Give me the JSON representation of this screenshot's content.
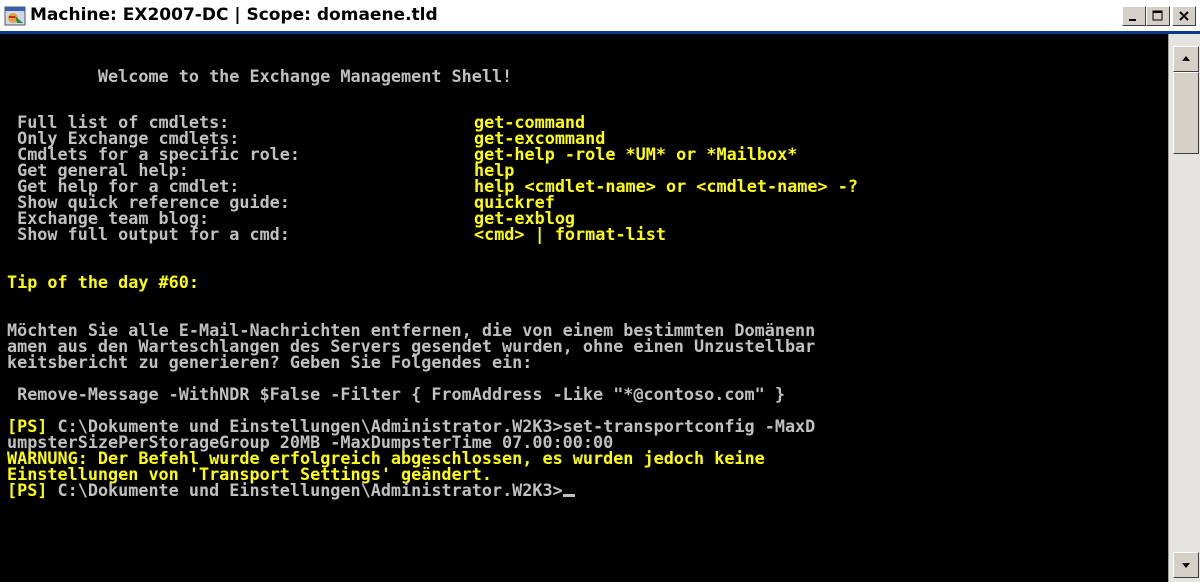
{
  "window": {
    "title": "Machine: EX2007-DC | Scope: domaene.tld",
    "icons": [
      "powershell-icon",
      "minimize-icon",
      "maximize-icon",
      "close-icon"
    ]
  },
  "console": {
    "welcome": "         Welcome to the Exchange Management Shell!",
    "help_rows": [
      {
        "label": " Full list of cmdlets:",
        "cmd": "get-command"
      },
      {
        "label": " Only Exchange cmdlets:",
        "cmd": "get-excommand"
      },
      {
        "label": " Cmdlets for a specific role:",
        "cmd": "get-help -role *UM* or *Mailbox*"
      },
      {
        "label": " Get general help:",
        "cmd": "help"
      },
      {
        "label": " Get help for a cmdlet:",
        "cmd": "help <cmdlet-name> or <cmdlet-name> -?"
      },
      {
        "label": " Show quick reference guide:",
        "cmd": "quickref"
      },
      {
        "label": " Exchange team blog:",
        "cmd": "get-exblog"
      },
      {
        "label": " Show full output for a cmd:",
        "cmd": "<cmd> | format-list"
      }
    ],
    "tip_title": "Tip of the day #60:",
    "tip_lines": [
      "Möchten Sie alle E-Mail-Nachrichten entfernen, die von einem bestimmten Domänenn",
      "amen aus den Warteschlangen des Servers gesendet wurden, ohne einen Unzustellbar",
      "keitsbericht zu generieren? Geben Sie Folgendes ein:"
    ],
    "tip_command": " Remove-Message -WithNDR $False -Filter { FromAddress -Like \"*@contoso.com\" }",
    "ps_prompt": "[PS]",
    "command_lines": [
      " C:\\Dokumente und Einstellungen\\Administrator.W2K3>set-transportconfig -MaxD",
      "umpsterSizePerStorageGroup 20MB -MaxDumpsterTime 07.00:00:00"
    ],
    "warning_lines": [
      "WARNUNG: Der Befehl wurde erfolgreich abgeschlossen, es wurden jedoch keine",
      "Einstellungen von 'Transport Settings' geändert."
    ],
    "final_prompt": " C:\\Dokumente und Einstellungen\\Administrator.W2K3>"
  },
  "colors": {
    "background": "#000000",
    "text": "#c0c0c0",
    "highlight": "#ffff00"
  }
}
